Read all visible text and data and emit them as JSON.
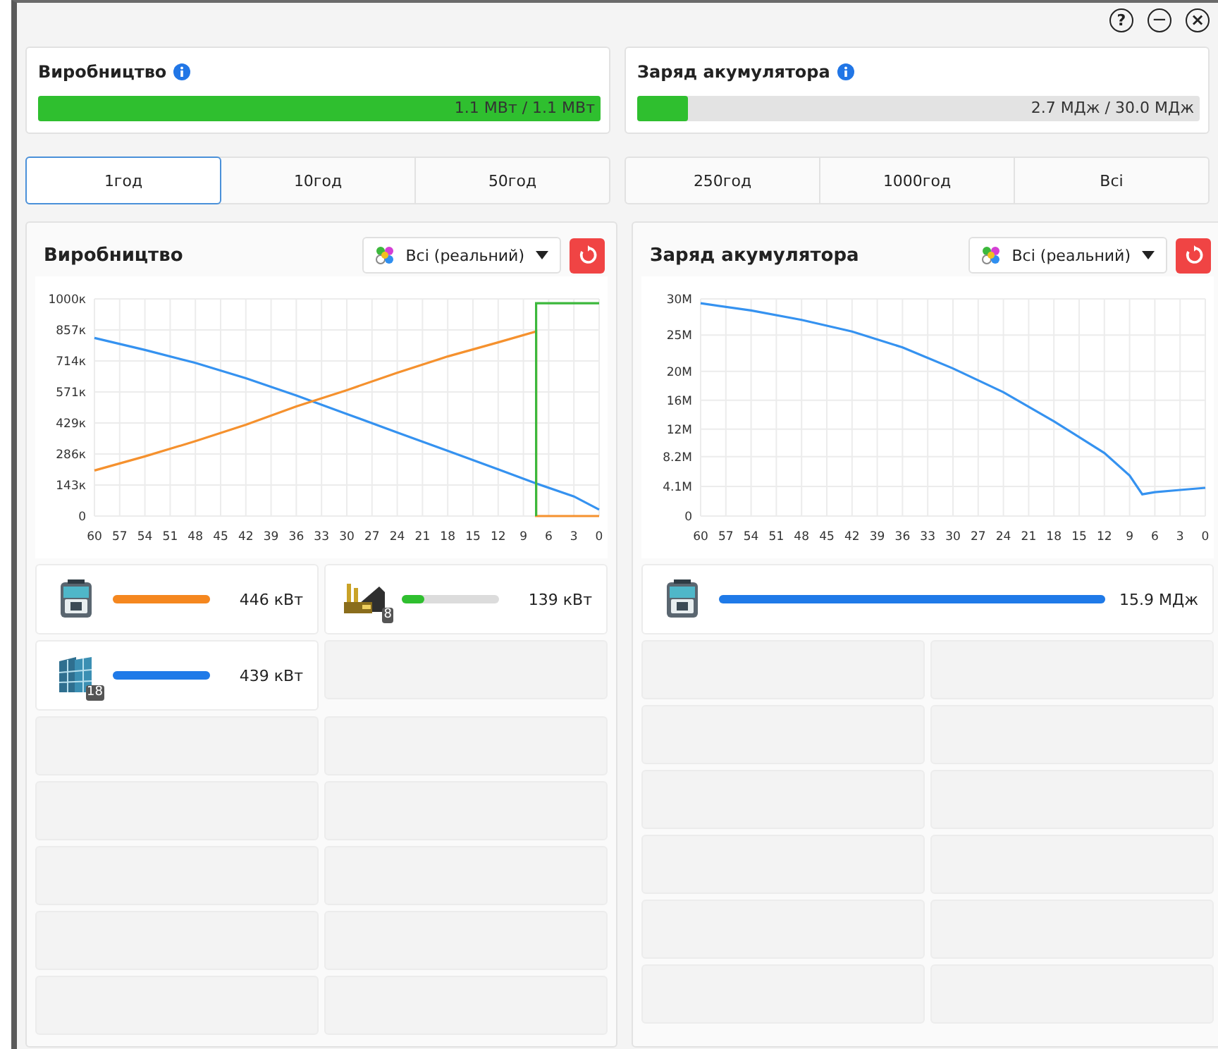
{
  "window_controls": [
    {
      "kind": "help",
      "label": "?"
    },
    {
      "kind": "minimize",
      "label": "−"
    },
    {
      "kind": "close",
      "label": "×"
    }
  ],
  "summaries": [
    {
      "title": "Виробництво",
      "level": 1.0,
      "reading": "1.1 МВт / 1.1 МВт"
    },
    {
      "title": "Заряд акумулятора",
      "level": 0.09,
      "reading": "2.7 МДж / 30.0 МДж"
    }
  ],
  "tabs": [
    [
      {
        "label": "1год",
        "selected": true
      },
      {
        "label": "10год",
        "selected": false
      },
      {
        "label": "50год",
        "selected": false
      }
    ],
    [
      {
        "label": "250год",
        "selected": false
      },
      {
        "label": "1000год",
        "selected": false
      },
      {
        "label": "Всі",
        "selected": false
      }
    ]
  ],
  "panels": [
    {
      "title": "Виробництво",
      "filter": "Всі (реальний)",
      "chart_data": {
        "type": "line",
        "grid": true,
        "xlim": [
          60,
          0
        ],
        "ylim": [
          0,
          1000
        ],
        "x": [
          60,
          54,
          48,
          42,
          36,
          30,
          24,
          18,
          12,
          7.5,
          7.5,
          3,
          0
        ],
        "xticks": [
          60,
          57,
          54,
          51,
          48,
          45,
          42,
          39,
          36,
          33,
          30,
          27,
          24,
          21,
          18,
          15,
          12,
          9,
          6,
          3,
          0
        ],
        "yticks": [
          {
            "value": 0,
            "label": "0"
          },
          {
            "value": 142.9,
            "label": "143к"
          },
          {
            "value": 285.7,
            "label": "286к"
          },
          {
            "value": 428.6,
            "label": "429к"
          },
          {
            "value": 571.4,
            "label": "571к"
          },
          {
            "value": 714.3,
            "label": "714к"
          },
          {
            "value": 857.1,
            "label": "857к"
          },
          {
            "value": 1000,
            "label": "1000к"
          }
        ],
        "series": [
          {
            "color": "#3592f0",
            "values": [
              820,
              765,
              705,
              635,
              555,
              470,
              385,
              300,
              215,
              150,
              150,
              90,
              30
            ]
          },
          {
            "color": "#f5912e",
            "values": [
              210,
              275,
              345,
              420,
              505,
              580,
              660,
              735,
              800,
              850,
              0,
              0,
              0
            ]
          },
          {
            "color": "#3cb83c",
            "values": [
              null,
              null,
              null,
              null,
              null,
              null,
              null,
              null,
              null,
              0,
              980,
              980,
              980
            ]
          }
        ]
      },
      "items": [
        {
          "kind": "machine",
          "color": "#f5871f",
          "level": 1.0,
          "reading": "446 кВт"
        },
        {
          "kind": "engine",
          "badge": "8",
          "color": "#2fbf2f",
          "level": 0.23,
          "reading": "139 кВт"
        },
        {
          "kind": "solar",
          "badge": "18",
          "color": "#1f7ae8",
          "level": 1.0,
          "reading": "439 кВт"
        }
      ]
    },
    {
      "title": "Заряд акумулятора",
      "filter": "Всі (реальний)",
      "chart_data": {
        "type": "line",
        "grid": true,
        "xlim": [
          60,
          0
        ],
        "ylim": [
          0,
          30
        ],
        "x": [
          60,
          54,
          48,
          42,
          36,
          30,
          24,
          18,
          12,
          9,
          7.5,
          6,
          3,
          0
        ],
        "xticks": [
          60,
          57,
          54,
          51,
          48,
          45,
          42,
          39,
          36,
          33,
          30,
          27,
          24,
          21,
          18,
          15,
          12,
          9,
          6,
          3,
          0
        ],
        "yticks": [
          {
            "value": 0,
            "label": "0"
          },
          {
            "value": 4.1,
            "label": "4.1M"
          },
          {
            "value": 8.2,
            "label": "8.2M"
          },
          {
            "value": 12,
            "label": "12M"
          },
          {
            "value": 16,
            "label": "16M"
          },
          {
            "value": 20,
            "label": "20M"
          },
          {
            "value": 25,
            "label": "25M"
          },
          {
            "value": 30,
            "label": "30M"
          }
        ],
        "series": [
          {
            "color": "#3592f0",
            "values": [
              29.4,
              28.4,
              27.1,
              25.5,
              23.3,
              20.4,
              17.1,
              13.1,
              8.7,
              5.6,
              3.0,
              3.3,
              3.6,
              3.9
            ]
          }
        ]
      },
      "items": [
        {
          "kind": "machine",
          "color": "#1f7ae8",
          "level": 1.0,
          "reading": "15.9 МДж"
        }
      ]
    }
  ]
}
